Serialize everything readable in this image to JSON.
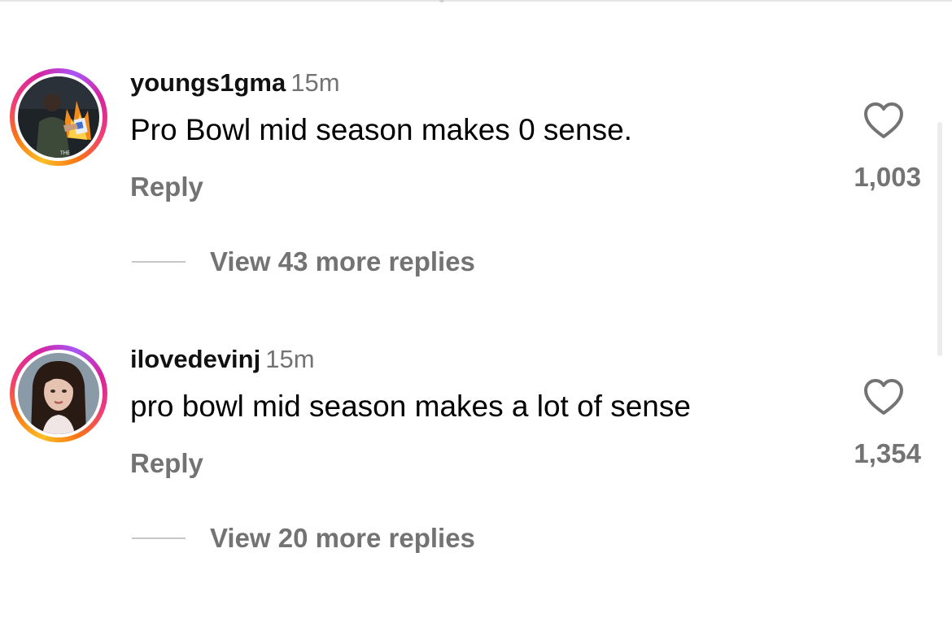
{
  "comments": [
    {
      "username": "youngs1gma",
      "time": "15m",
      "text": "Pro Bowl mid season makes 0 sense.",
      "reply_label": "Reply",
      "like_count": "1,003",
      "view_replies_label": "View 43 more replies",
      "avatar_icon": "profile-photo-fire-scene",
      "like_icon": "heart-outline-icon"
    },
    {
      "username": "ilovedevinj",
      "time": "15m",
      "text": "pro bowl mid season makes a lot of sense",
      "reply_label": "Reply",
      "like_count": "1,354",
      "view_replies_label": "View 20 more replies",
      "avatar_icon": "profile-photo-woman-portrait",
      "like_icon": "heart-outline-icon"
    }
  ],
  "colors": {
    "secondary_text": "#737373",
    "primary_text": "#000000",
    "story_ring": [
      "#fbbf24",
      "#f97316",
      "#ef3b7a",
      "#d6249f"
    ]
  }
}
